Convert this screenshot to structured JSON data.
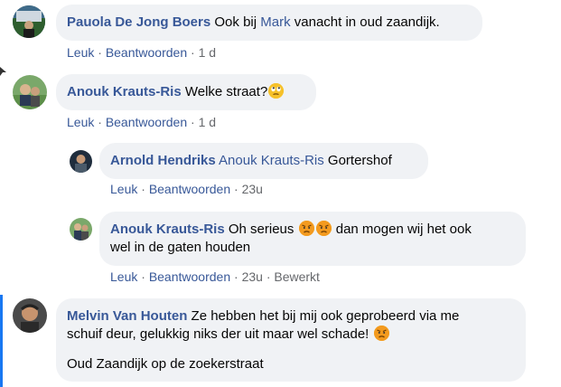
{
  "comments": [
    {
      "author": "Pauola De Jong Boers",
      "text_before": "Ook bij ",
      "mention": "Mark",
      "text_after": " vanacht in oud zaandijk.",
      "like": "Leuk",
      "reply": "Beantwoorden",
      "time": "1 d"
    },
    {
      "author": "Anouk Krauts-Ris",
      "text": "Welke straat?",
      "emoji": "rolling-eyes-emoji",
      "like": "Leuk",
      "reply": "Beantwoorden",
      "time": "1 d"
    },
    {
      "author": "Arnold Hendriks",
      "mention": "Anouk Krauts-Ris",
      "text": " Gortershof",
      "like": "Leuk",
      "reply": "Beantwoorden",
      "time": "23u"
    },
    {
      "author": "Anouk Krauts-Ris",
      "text_line1a": "Oh serieus ",
      "text_line1b": " dan mogen wij het ook",
      "text_line2": "wel in de gaten houden",
      "emoji": "angry-emoji",
      "like": "Leuk",
      "reply": "Beantwoorden",
      "time": "23u",
      "edited": "Bewerkt"
    },
    {
      "author": "Melvin Van Houten",
      "text_line1": " Ze hebben het bij mij ook geprobeerd via me",
      "text_line2": "schuif deur, gelukkig niks der uit maar wel schade! ",
      "text_para2": "Oud Zaandijk op de zoekerstraat",
      "emoji": "angry-emoji"
    }
  ],
  "separator": "·",
  "colors": {
    "name": "#385898",
    "bubble": "#f0f2f5",
    "meta": "#65676b",
    "thread": "#1877f2"
  }
}
